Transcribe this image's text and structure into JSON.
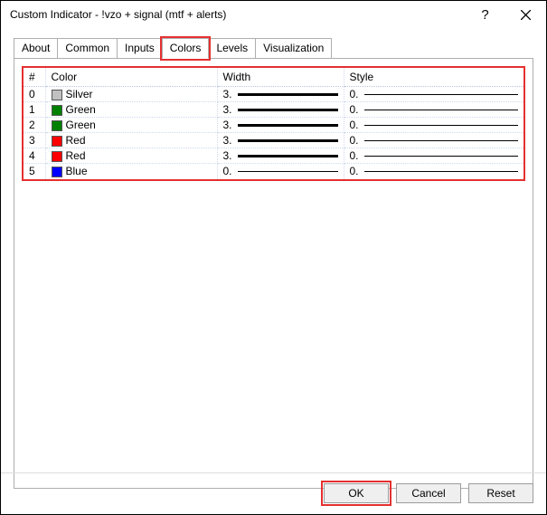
{
  "window": {
    "title": "Custom Indicator - !vzo + signal (mtf + alerts)"
  },
  "tabs": {
    "about": "About",
    "common": "Common",
    "inputs": "Inputs",
    "colors": "Colors",
    "levels": "Levels",
    "visualization": "Visualization",
    "active": "colors"
  },
  "table": {
    "headers": {
      "idx": "#",
      "color": "Color",
      "width": "Width",
      "style": "Style"
    },
    "rows": [
      {
        "idx": "0",
        "color_name": "Silver",
        "color_hex": "#c0c0c0",
        "width": "3",
        "style": "0",
        "line_w": 3,
        "style_w": 1
      },
      {
        "idx": "1",
        "color_name": "Green",
        "color_hex": "#008000",
        "width": "3",
        "style": "0",
        "line_w": 3,
        "style_w": 1
      },
      {
        "idx": "2",
        "color_name": "Green",
        "color_hex": "#008000",
        "width": "3",
        "style": "0",
        "line_w": 3,
        "style_w": 1
      },
      {
        "idx": "3",
        "color_name": "Red",
        "color_hex": "#ff0000",
        "width": "3",
        "style": "0",
        "line_w": 3,
        "style_w": 1
      },
      {
        "idx": "4",
        "color_name": "Red",
        "color_hex": "#ff0000",
        "width": "3",
        "style": "0",
        "line_w": 3,
        "style_w": 1
      },
      {
        "idx": "5",
        "color_name": "Blue",
        "color_hex": "#0000ff",
        "width": "0",
        "style": "0",
        "line_w": 1,
        "style_w": 1
      }
    ]
  },
  "buttons": {
    "ok": "OK",
    "cancel": "Cancel",
    "reset": "Reset"
  }
}
